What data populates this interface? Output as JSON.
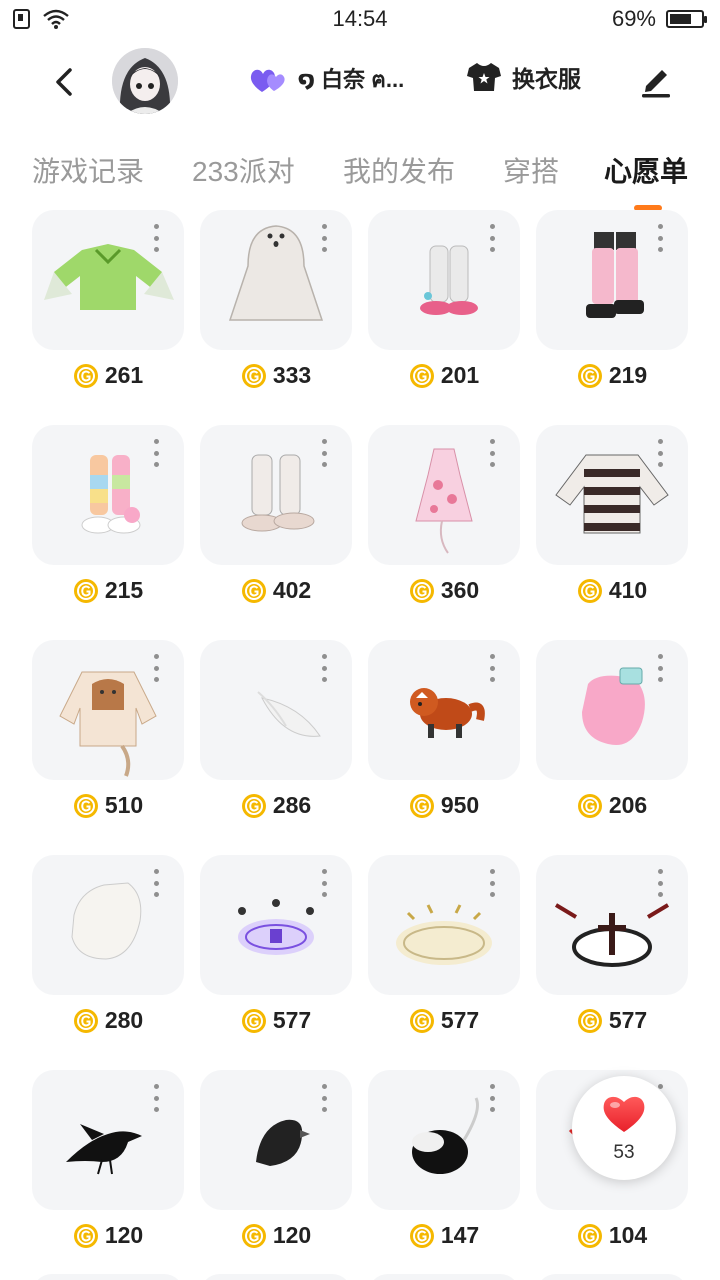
{
  "status_bar": {
    "time": "14:54",
    "battery_percent_label": "69%",
    "battery_level": 0.69
  },
  "header": {
    "username": "໑ 白奈 ฅ...",
    "outfit_label": "换衣服",
    "heart_icon_color": "#7a5cf0"
  },
  "tabs": [
    {
      "label": "游戏记录",
      "active": false
    },
    {
      "label": "233派对",
      "active": false
    },
    {
      "label": "我的发布",
      "active": false
    },
    {
      "label": "穿搭",
      "active": false
    },
    {
      "label": "心愿单",
      "active": true
    }
  ],
  "accent_color": "#ff7a1a",
  "coin_color": "#f5b800",
  "wishlist": [
    {
      "icon": "green-sleeve-top",
      "price": "261"
    },
    {
      "icon": "ghost-costume",
      "price": "333"
    },
    {
      "icon": "white-leg-warmers-pink-sandals",
      "price": "201"
    },
    {
      "icon": "pink-leg-warmers-boots",
      "price": "219"
    },
    {
      "icon": "rainbow-leg-warmers",
      "price": "215"
    },
    {
      "icon": "white-fluffy-boots",
      "price": "402"
    },
    {
      "icon": "pink-floral-dress",
      "price": "360"
    },
    {
      "icon": "striped-sweater",
      "price": "410"
    },
    {
      "icon": "cat-print-sweater",
      "price": "510"
    },
    {
      "icon": "white-feather",
      "price": "286"
    },
    {
      "icon": "red-panda",
      "price": "950"
    },
    {
      "icon": "pink-paw-glove",
      "price": "206"
    },
    {
      "icon": "white-paw-glove",
      "price": "280"
    },
    {
      "icon": "purple-magic-circle",
      "price": "577"
    },
    {
      "icon": "gold-magic-circle",
      "price": "577"
    },
    {
      "icon": "dark-cross-magic-circle",
      "price": "577"
    },
    {
      "icon": "black-crow",
      "price": "120"
    },
    {
      "icon": "black-bird-pet",
      "price": "120"
    },
    {
      "icon": "black-hat-ribbon",
      "price": "147"
    },
    {
      "icon": "red-item",
      "price": "104"
    }
  ],
  "like_bubble": {
    "count": "53"
  }
}
